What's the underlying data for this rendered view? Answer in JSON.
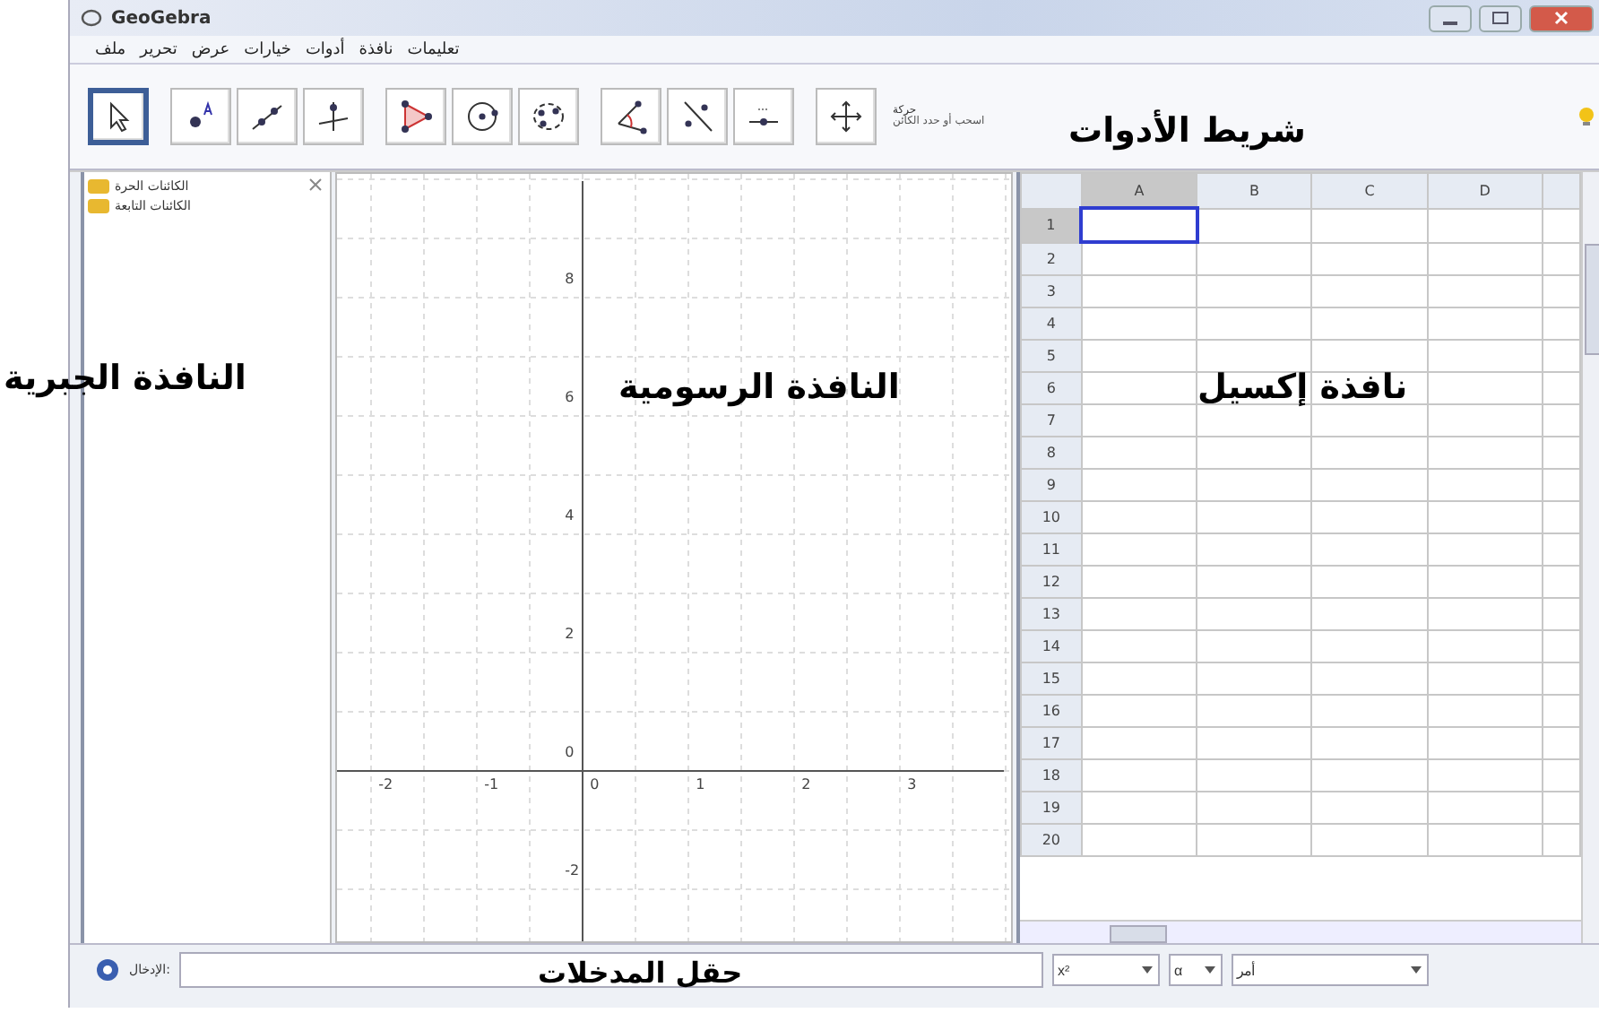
{
  "window": {
    "title": "GeoGebra"
  },
  "menu": [
    "تعليمات",
    "نافذة",
    "أدوات",
    "خيارات",
    "عرض",
    "تحرير",
    "ملف"
  ],
  "tools": [
    {
      "kind": "pointer",
      "selected": true
    },
    {
      "kind": "point",
      "selected": false
    },
    {
      "kind": "line",
      "selected": false
    },
    {
      "kind": "perpendicular",
      "selected": false
    },
    {
      "kind": "polygon",
      "selected": false
    },
    {
      "kind": "circle",
      "selected": false
    },
    {
      "kind": "conic",
      "selected": false
    },
    {
      "kind": "angle",
      "selected": false
    },
    {
      "kind": "reflect",
      "selected": false
    },
    {
      "kind": "slider",
      "selected": false
    },
    {
      "kind": "move-view",
      "selected": false
    }
  ],
  "tool_hint": {
    "name": "حركة",
    "description": "اسحب أو حدد الكائن"
  },
  "algebra": {
    "folders": [
      "الكائنات الحرة",
      "الكائنات التابعة"
    ]
  },
  "graphics": {
    "x_ticks": [
      "3",
      "2",
      "1",
      "0",
      "-1",
      "-2"
    ],
    "y_ticks": [
      "8",
      "6",
      "4",
      "2",
      "0",
      "-2"
    ]
  },
  "spreadsheet": {
    "columns": [
      {
        "label": "D",
        "selected": false
      },
      {
        "label": "C",
        "selected": false
      },
      {
        "label": "B",
        "selected": false
      },
      {
        "label": "A",
        "selected": true
      }
    ],
    "rows": [
      {
        "label": "1",
        "selected": true
      },
      {
        "label": "2",
        "selected": false
      },
      {
        "label": "3",
        "selected": false
      },
      {
        "label": "4",
        "selected": false
      },
      {
        "label": "5",
        "selected": false
      },
      {
        "label": "6",
        "selected": false
      },
      {
        "label": "7",
        "selected": false
      },
      {
        "label": "8",
        "selected": false
      },
      {
        "label": "9",
        "selected": false
      },
      {
        "label": "10",
        "selected": false
      },
      {
        "label": "11",
        "selected": false
      },
      {
        "label": "12",
        "selected": false
      },
      {
        "label": "13",
        "selected": false
      },
      {
        "label": "14",
        "selected": false
      },
      {
        "label": "15",
        "selected": false
      },
      {
        "label": "16",
        "selected": false
      },
      {
        "label": "17",
        "selected": false
      },
      {
        "label": "18",
        "selected": false
      },
      {
        "label": "19",
        "selected": false
      },
      {
        "label": "20",
        "selected": false
      }
    ]
  },
  "input_bar": {
    "label": "الإدخال:",
    "dropdowns": [
      "أمر",
      "α",
      "x²"
    ]
  },
  "annotations": {
    "toolbar": "شريط الأدوات",
    "algebra": "النافذة الجبرية",
    "graphics": "النافذة الرسومية",
    "spreadsheet": "نافذة إكسيل",
    "input": "حقل المدخلات"
  }
}
